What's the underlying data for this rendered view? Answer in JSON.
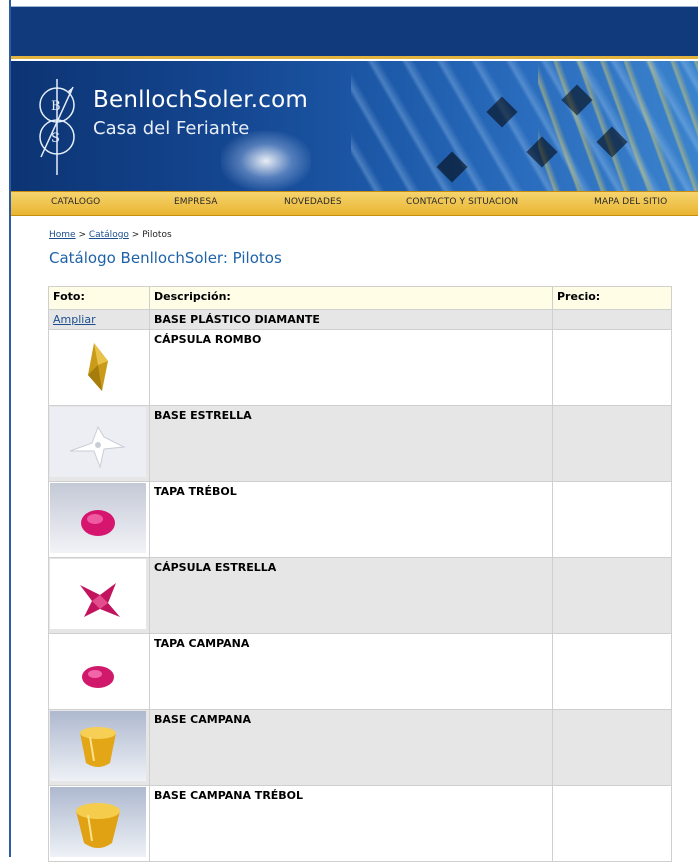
{
  "brand": {
    "title": "BenllochSoler.com",
    "subtitle": "Casa del Feriante",
    "logo_letters": [
      "B",
      "S"
    ]
  },
  "nav": [
    {
      "label": "CATALOGO"
    },
    {
      "label": "EMPRESA"
    },
    {
      "label": "NOVEDADES"
    },
    {
      "label": "CONTACTO Y SITUACION"
    },
    {
      "label": "MAPA DEL SITIO"
    }
  ],
  "breadcrumb": {
    "home": "Home",
    "sep1": " > ",
    "catalog": "Catálogo",
    "sep2": " > ",
    "current": "Pilotos"
  },
  "page_title": "Catálogo BenllochSoler: Pilotos",
  "table": {
    "headers": {
      "foto": "Foto:",
      "descripcion": "Descripción:",
      "precio": "Precio:"
    },
    "first_row": {
      "link": "Ampliar",
      "descripcion": "BASE PLÁSTICO DIAMANTE",
      "precio": ""
    },
    "rows": [
      {
        "descripcion": "CÁPSULA ROMBO",
        "image": "yellow-rhombus-capsule-photo",
        "precio": ""
      },
      {
        "descripcion": "BASE ESTRELLA",
        "image": "white-star-base-photo",
        "precio": ""
      },
      {
        "descripcion": "TAPA TRÉBOL",
        "image": "pink-clover-cap-photo",
        "precio": ""
      },
      {
        "descripcion": "CÁPSULA ESTRELLA",
        "image": "pink-star-capsule-photo",
        "precio": ""
      },
      {
        "descripcion": "TAPA CAMPANA",
        "image": "pink-bell-cap-photo",
        "precio": ""
      },
      {
        "descripcion": "BASE CAMPANA",
        "image": "yellow-bell-base-photo",
        "precio": ""
      },
      {
        "descripcion": "BASE CAMPANA TRÉBOL",
        "image": "yellow-bell-clover-base-photo",
        "precio": ""
      }
    ]
  },
  "colors": {
    "topbar": "#103a7c",
    "nav_gold": "#e9b531",
    "title_blue": "#1e62a8",
    "row_grey": "#e6e6e6",
    "header_cream": "#fffde6"
  }
}
